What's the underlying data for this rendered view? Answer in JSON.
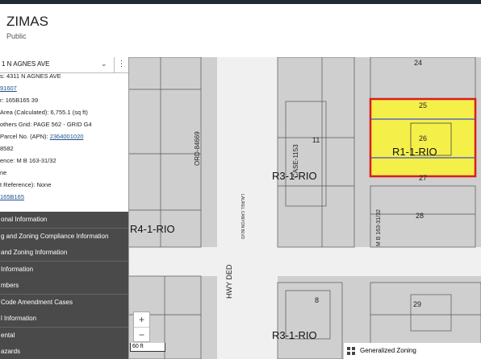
{
  "app": {
    "title": "ZIMAS",
    "subtitle": "Public"
  },
  "search": {
    "value": "1 N AGNES AVE"
  },
  "panel": {
    "rows": [
      {
        "label": "s:",
        "value": "4311 N AGNES AVE",
        "link": false
      },
      {
        "label": "",
        "value": "91607",
        "link": true
      },
      {
        "label": "r:",
        "value": "165B165   39",
        "link": false
      },
      {
        "label": "Area (Calculated):",
        "value": "6,755.1 (sq ft)",
        "link": false
      },
      {
        "label": "others Grid:",
        "value": "PAGE 562 - GRID G4",
        "link": false
      },
      {
        "label": "Parcel No. (APN):",
        "value": "2364001020",
        "link": true
      },
      {
        "label": "",
        "value": "8582",
        "link": false
      },
      {
        "label": "ence:",
        "value": "M B 163-31/32",
        "link": false
      },
      {
        "label": "",
        "value": "ne",
        "link": false
      },
      {
        "label": "t Reference):",
        "value": "None",
        "link": false
      },
      {
        "label": "",
        "value": "165B165",
        "link": true
      }
    ],
    "sections": [
      "onal Information",
      "g and Zoning Compliance Information",
      "and Zoning Information",
      "Information",
      "mbers",
      "Code Amendment Cases",
      "l Information",
      "ental",
      "azards"
    ]
  },
  "map": {
    "zones": [
      "R4-1-RIO",
      "R3-1-RIO",
      "R1-1-RIO",
      "R3-1-RIO"
    ],
    "labels": [
      "ORD-84669",
      "CASE-1153",
      "M B 163-31/32",
      "LAUREL CANYON BLVD",
      "HWY DED"
    ],
    "lots": [
      "24",
      "25",
      "26",
      "27",
      "28",
      "29",
      "11",
      "8"
    ],
    "zoom_in": "+",
    "zoom_out": "−",
    "scale": "60 ft",
    "legend": "Generalized Zoning"
  },
  "colors": {
    "selected_fill": "#f5ef4a",
    "selected_border": "#d81e1e",
    "section_bg": "#4a4a4a",
    "link": "#1a4f8a"
  }
}
